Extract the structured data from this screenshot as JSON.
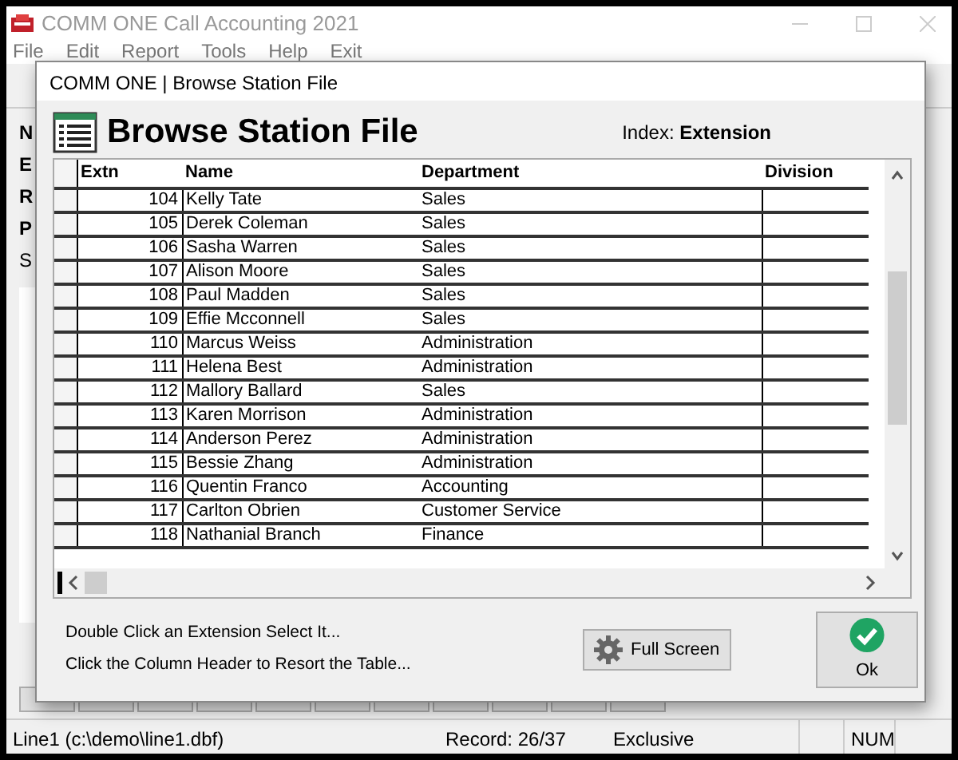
{
  "window": {
    "title": "COMM ONE Call Accounting 2021"
  },
  "menu": [
    "File",
    "Edit",
    "Report",
    "Tools",
    "Help",
    "Exit"
  ],
  "side_links": [
    "N",
    "E",
    "R",
    "P"
  ],
  "side_label": "S",
  "dialog": {
    "title": "COMM ONE | Browse Station File",
    "heading": "Browse Station File",
    "index_label": "Index:",
    "index_value": "Extension",
    "columns": [
      "Extn",
      "Name",
      "Department",
      "Division"
    ],
    "rows": [
      {
        "extn": "104",
        "name": "Kelly Tate",
        "department": "Sales"
      },
      {
        "extn": "105",
        "name": "Derek Coleman",
        "department": "Sales"
      },
      {
        "extn": "106",
        "name": "Sasha Warren",
        "department": "Sales"
      },
      {
        "extn": "107",
        "name": "Alison Moore",
        "department": "Sales"
      },
      {
        "extn": "108",
        "name": "Paul Madden",
        "department": "Sales"
      },
      {
        "extn": "109",
        "name": "Effie Mcconnell",
        "department": "Sales"
      },
      {
        "extn": "110",
        "name": "Marcus Weiss",
        "department": "Administration"
      },
      {
        "extn": "111",
        "name": "Helena Best",
        "department": "Administration"
      },
      {
        "extn": "112",
        "name": "Mallory Ballard",
        "department": "Sales"
      },
      {
        "extn": "113",
        "name": "Karen Morrison",
        "department": "Administration"
      },
      {
        "extn": "114",
        "name": "Anderson Perez",
        "department": "Administration"
      },
      {
        "extn": "115",
        "name": "Bessie Zhang",
        "department": "Administration"
      },
      {
        "extn": "116",
        "name": "Quentin Franco",
        "department": "Accounting"
      },
      {
        "extn": "117",
        "name": "Carlton Obrien",
        "department": "Customer Service"
      },
      {
        "extn": "118",
        "name": "Nathanial Branch",
        "department": "Finance"
      }
    ],
    "hints": [
      "Double Click an Extension Select It...",
      "Click the Column Header to Resort the Table..."
    ],
    "fullscreen_button": "Full Screen",
    "ok_button": "Ok"
  },
  "status_bar": [
    "Line1 (c:\\demo\\line1.dbf)",
    "Record: 26/37",
    "Exclusive",
    "NUM"
  ]
}
